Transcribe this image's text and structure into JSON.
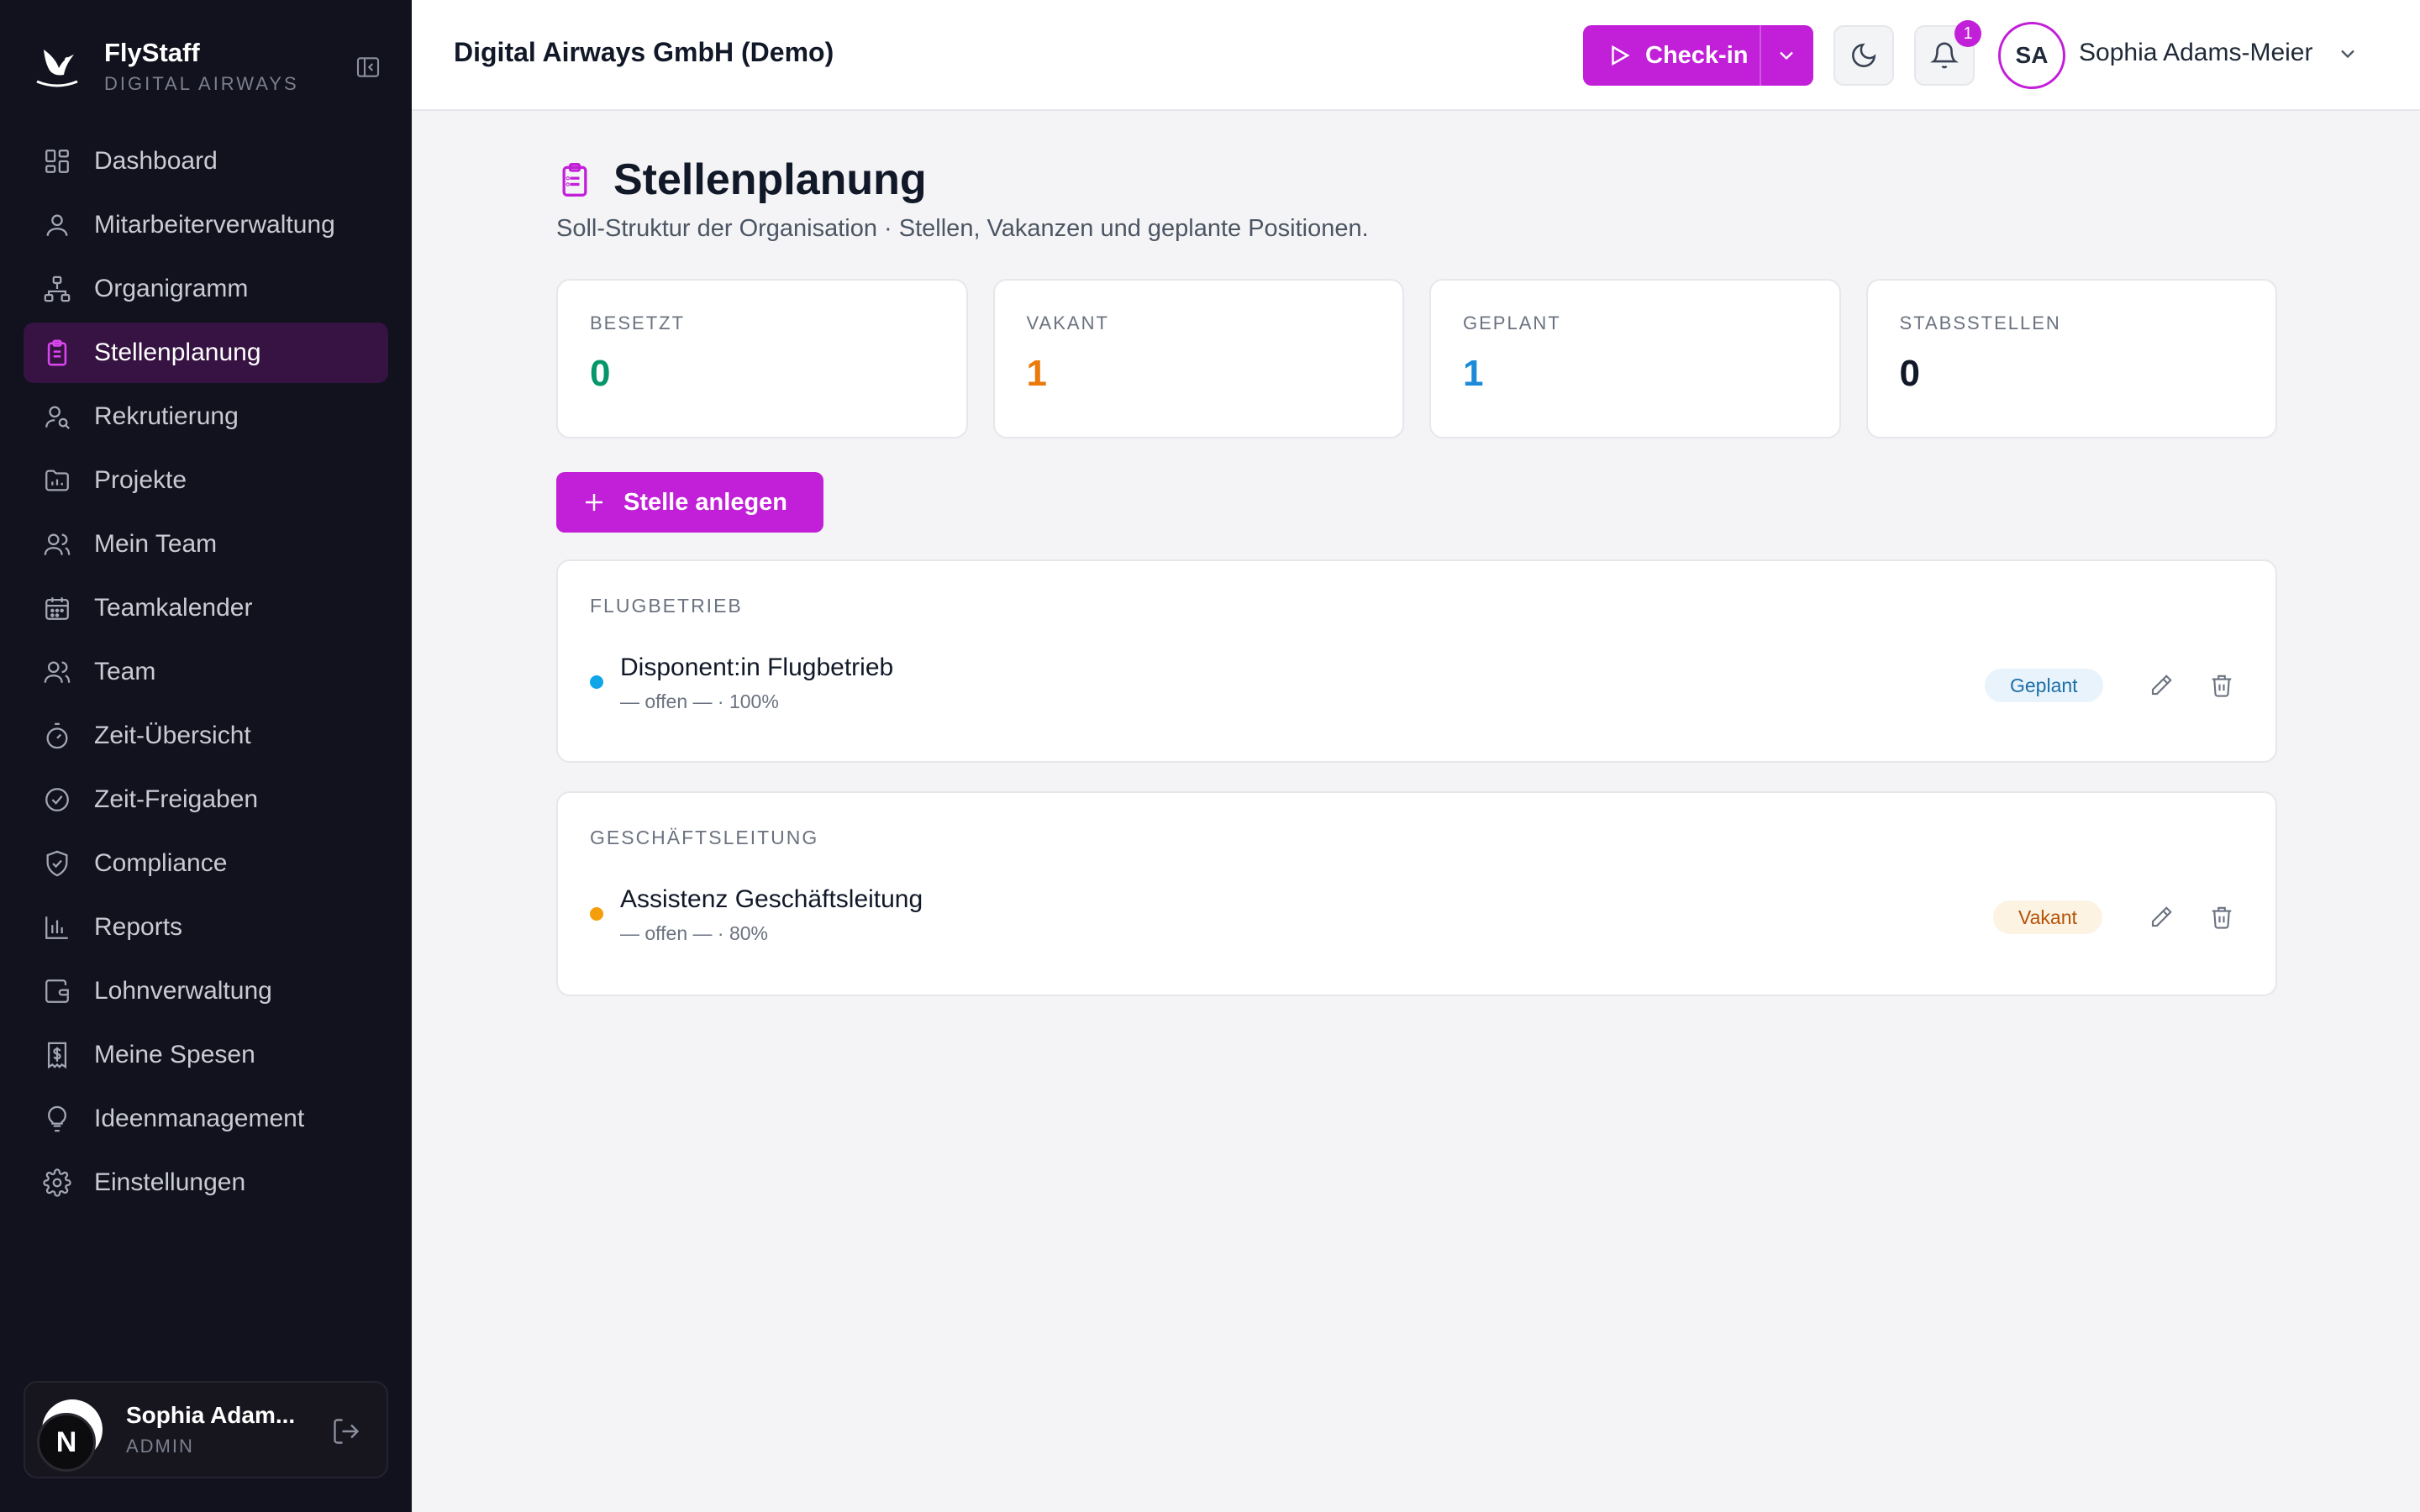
{
  "brand": {
    "name": "FlyStaff",
    "sub": "DIGITAL AIRWAYS"
  },
  "sidebar": {
    "items": [
      {
        "label": "Dashboard",
        "icon": "grid-icon"
      },
      {
        "label": "Mitarbeiterverwaltung",
        "icon": "user-icon"
      },
      {
        "label": "Organigramm",
        "icon": "org-chart-icon"
      },
      {
        "label": "Stellenplanung",
        "icon": "clipboard-icon",
        "active": true
      },
      {
        "label": "Rekrutierung",
        "icon": "user-search-icon"
      },
      {
        "label": "Projekte",
        "icon": "folder-chart-icon"
      },
      {
        "label": "Mein Team",
        "icon": "users-icon"
      },
      {
        "label": "Teamkalender",
        "icon": "calendar-icon"
      },
      {
        "label": "Team",
        "icon": "users-icon"
      },
      {
        "label": "Zeit-Übersicht",
        "icon": "timer-icon"
      },
      {
        "label": "Zeit-Freigaben",
        "icon": "check-circle-icon"
      },
      {
        "label": "Compliance",
        "icon": "shield-check-icon"
      },
      {
        "label": "Reports",
        "icon": "bar-chart-icon"
      },
      {
        "label": "Lohnverwaltung",
        "icon": "wallet-icon"
      },
      {
        "label": "Meine Spesen",
        "icon": "receipt-icon"
      },
      {
        "label": "Ideenmanagement",
        "icon": "lightbulb-icon"
      },
      {
        "label": "Einstellungen",
        "icon": "gear-icon"
      }
    ]
  },
  "user_card": {
    "name": "Sophia Adam...",
    "role": "ADMIN",
    "initial": "N"
  },
  "header": {
    "company": "Digital Airways GmbH (Demo)",
    "checkin_label": "Check-in",
    "notification_count": "1",
    "avatar_initials": "SA",
    "user_name": "Sophia Adams-Meier"
  },
  "page": {
    "title": "Stellenplanung",
    "subtitle": "Soll-Struktur der Organisation · Stellen, Vakanzen und geplante Positionen."
  },
  "stats": [
    {
      "label": "BESETZT",
      "value": "0",
      "color": "#059669"
    },
    {
      "label": "VAKANT",
      "value": "1",
      "color": "#ea7a0c"
    },
    {
      "label": "GEPLANT",
      "value": "1",
      "color": "#1c8ad8"
    },
    {
      "label": "STABSSTELLEN",
      "value": "0",
      "color": "#111827"
    }
  ],
  "add_button": "Stelle anlegen",
  "groups": [
    {
      "title": "FLUGBETRIEB",
      "positions": [
        {
          "title": "Disponent:in Flugbetrieb",
          "meta": "— offen — · 100%",
          "status": "Geplant",
          "dot": "#0ea5e9"
        }
      ]
    },
    {
      "title": "GESCHÄFTSLEITUNG",
      "positions": [
        {
          "title": "Assistenz Geschäftsleitung",
          "meta": "— offen — · 80%",
          "status": "Vakant",
          "dot": "#f59e0b"
        }
      ]
    }
  ],
  "colors": {
    "accent": "#c21fd8",
    "sidebar_bg": "#12111e",
    "active_bg": "#361342"
  }
}
